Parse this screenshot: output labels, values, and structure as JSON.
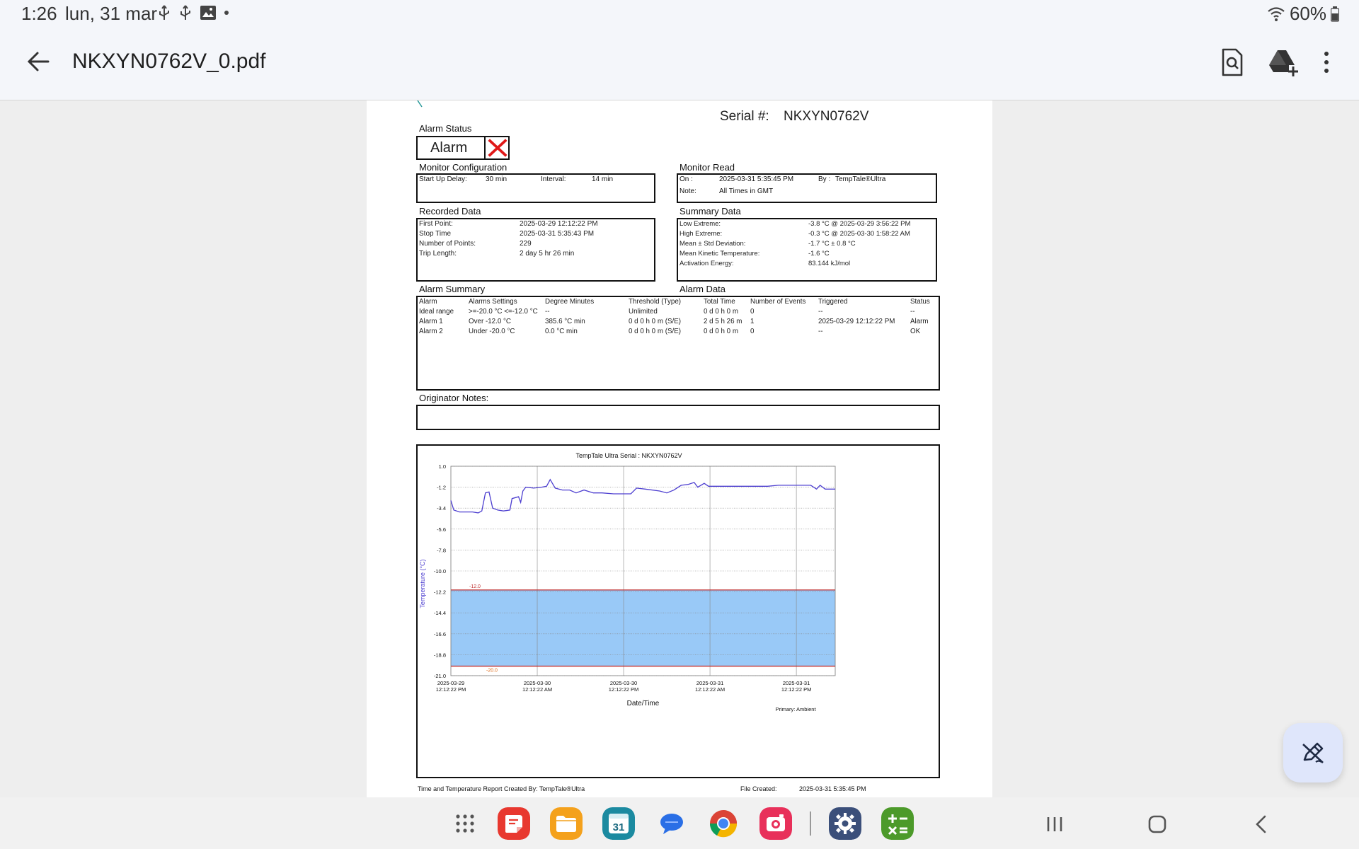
{
  "status_bar": {
    "time": "1:26",
    "date": "lun, 31 mar",
    "battery": "60%",
    "icons": [
      "usb-icon",
      "usb-icon",
      "image-icon",
      "dot-icon",
      "wifi-icon",
      "battery-icon"
    ]
  },
  "app_bar": {
    "title": "NKXYN0762V_0.pdf",
    "actions": [
      "find-in-document-icon",
      "add-to-drive-icon",
      "more-options-icon"
    ]
  },
  "report": {
    "serial_label": "Serial #:",
    "serial": "NKXYN0762V",
    "alarm_status_label": "Alarm Status",
    "alarm_status": "Alarm",
    "monitor_config": {
      "title": "Monitor Configuration",
      "startup_delay_label": "Start Up Delay:",
      "startup_delay": "30 min",
      "interval_label": "Interval:",
      "interval": "14 min"
    },
    "monitor_read": {
      "title": "Monitor Read",
      "on_label": "On :",
      "on": "2025-03-31  5:35:45 PM",
      "by_label": "By :",
      "by": "TempTale®Ultra",
      "note_label": "Note:",
      "note": "All Times in GMT"
    },
    "recorded_data": {
      "title": "Recorded Data",
      "rows": [
        {
          "label": "First Point:",
          "value": "2025-03-29 12:12:22 PM"
        },
        {
          "label": "Stop Time",
          "value": "2025-03-31  5:35:43 PM"
        },
        {
          "label": "Number of Points:",
          "value": "229"
        },
        {
          "label": "Trip Length:",
          "value": "2 day 5 hr 26 min"
        }
      ]
    },
    "summary_data": {
      "title": "Summary Data",
      "rows": [
        {
          "label": "Low Extreme:",
          "value": "-3.8 °C @ 2025-03-29  3:56:22 PM"
        },
        {
          "label": "High Extreme:",
          "value": "-0.3 °C @ 2025-03-30  1:58:22 AM"
        },
        {
          "label": "Mean ± Std Deviation:",
          "value": "-1.7 °C ± 0.8 °C"
        },
        {
          "label": "Mean Kinetic Temperature:",
          "value": "-1.6 °C"
        },
        {
          "label": "Activation Energy:",
          "value": "83.144 kJ/mol"
        }
      ]
    },
    "alarm_summary_title": "Alarm Summary",
    "alarm_data_title": "Alarm Data",
    "alarm_table": {
      "headers": [
        "Alarm",
        "Alarms Settings",
        "Degree Minutes",
        "Threshold (Type)",
        "Total Time",
        "Number of Events",
        "Triggered",
        "Status"
      ],
      "rows": [
        [
          "Ideal range",
          ">=-20.0 °C <=-12.0 °C",
          "--",
          "Unlimited",
          "0 d 0 h 0 m",
          "0",
          "--",
          "--"
        ],
        [
          "Alarm 1",
          "Over -12.0 °C",
          "385.6 °C min",
          "0 d 0 h 0 m (S/E)",
          "2 d 5 h 26 m",
          "1",
          "2025-03-29 12:12:22 PM",
          "Alarm"
        ],
        [
          "Alarm 2",
          "Under -20.0 °C",
          "0.0 °C min",
          "0 d 0 h 0 m (S/E)",
          "0 d 0 h 0 m",
          "0",
          "--",
          "OK"
        ]
      ]
    },
    "originator_notes_label": "Originator Notes:",
    "footer_left": "Time and Temperature Report Created By:  TempTale®Ultra",
    "footer_file_label": "File Created:",
    "footer_file": "2025-03-31  5:35:45 PM"
  },
  "chart_data": {
    "type": "line",
    "title": "TempTale Ultra  Serial : NKXYN0762V",
    "xlabel": "Date/Time",
    "ylabel": "Temperature    (°C)",
    "ylim": [
      -21.0,
      1.0
    ],
    "yticks": [
      "1.0",
      "-1.2",
      "-3.4",
      "-5.6",
      "-7.8",
      "-10.0",
      "-12.2",
      "-14.4",
      "-16.6",
      "-18.8",
      "-21.0"
    ],
    "xticks": [
      [
        "2025-03-29",
        "12:12:22 PM"
      ],
      [
        "2025-03-30",
        "12:12:22 AM"
      ],
      [
        "2025-03-30",
        "12:12:22 PM"
      ],
      [
        "2025-03-31",
        "12:12:22 AM"
      ],
      [
        "2025-03-31",
        "12:12:22 PM"
      ]
    ],
    "x_unit": "hours since 2025-03-29 12:12:22 PM",
    "x_range": [
      0,
      53.4
    ],
    "upper_limit": {
      "value": -12.0,
      "label": "-12.0"
    },
    "lower_limit": {
      "value": -20.0,
      "label": "-20.0"
    },
    "band_color": "#99c9f7",
    "line_color": "#4d3fd0",
    "limit_color": "#c03030",
    "legend": "Primary: Ambient",
    "series": [
      {
        "name": "Primary: Ambient",
        "points": [
          [
            0,
            -2.6
          ],
          [
            0.4,
            -3.6
          ],
          [
            1.2,
            -3.8
          ],
          [
            2.2,
            -3.8
          ],
          [
            3.0,
            -3.8
          ],
          [
            3.8,
            -3.9
          ],
          [
            4.3,
            -3.7
          ],
          [
            4.8,
            -1.8
          ],
          [
            5.3,
            -1.7
          ],
          [
            5.8,
            -3.4
          ],
          [
            6.5,
            -3.6
          ],
          [
            7.3,
            -3.7
          ],
          [
            8.2,
            -3.6
          ],
          [
            8.5,
            -2.4
          ],
          [
            9.4,
            -2.2
          ],
          [
            9.7,
            -2.8
          ],
          [
            10.0,
            -1.6
          ],
          [
            10.4,
            -1.2
          ],
          [
            11.5,
            -1.3
          ],
          [
            12.6,
            -1.2
          ],
          [
            13.3,
            -1.1
          ],
          [
            13.8,
            -0.4
          ],
          [
            14.5,
            -1.3
          ],
          [
            15.5,
            -1.5
          ],
          [
            16.5,
            -1.5
          ],
          [
            17.4,
            -1.8
          ],
          [
            18.5,
            -1.5
          ],
          [
            19.8,
            -1.8
          ],
          [
            21.0,
            -1.8
          ],
          [
            22.6,
            -1.9
          ],
          [
            24.0,
            -1.9
          ],
          [
            25.0,
            -1.9
          ],
          [
            25.8,
            -1.3
          ],
          [
            27.0,
            -1.4
          ],
          [
            29.0,
            -1.6
          ],
          [
            30.0,
            -1.8
          ],
          [
            31.0,
            -1.5
          ],
          [
            32.0,
            -1.0
          ],
          [
            33.0,
            -0.9
          ],
          [
            33.8,
            -0.7
          ],
          [
            34.3,
            -1.2
          ],
          [
            35.2,
            -0.8
          ],
          [
            35.8,
            -1.1
          ],
          [
            36.6,
            -1.1
          ],
          [
            40.0,
            -1.1
          ],
          [
            44.0,
            -1.1
          ],
          [
            45.5,
            -1.0
          ],
          [
            50.0,
            -1.0
          ],
          [
            50.8,
            -1.4
          ],
          [
            51.3,
            -1.0
          ],
          [
            52.0,
            -1.4
          ],
          [
            53.4,
            -1.4
          ]
        ]
      }
    ]
  },
  "dock": {
    "apps": [
      "app-drawer-icon",
      "notes-app-icon",
      "files-app-icon",
      "calendar-app-icon",
      "messages-app-icon",
      "chrome-app-icon",
      "camera-app-icon",
      "settings-app-icon",
      "calculator-app-icon"
    ],
    "calendar_day": "31",
    "nav": [
      "recents-icon",
      "home-icon",
      "back-nav-icon"
    ]
  }
}
